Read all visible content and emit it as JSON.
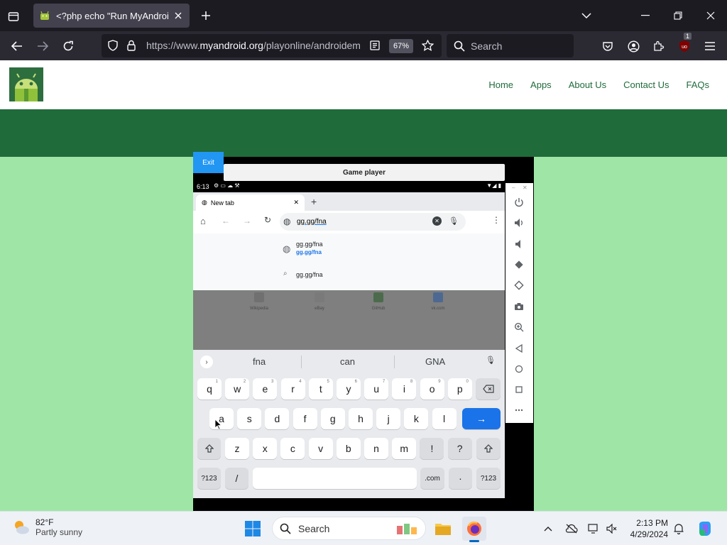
{
  "browser": {
    "tab_title": "<?php echo \"Run MyAndroid\"; ?>",
    "url_prefix": "https://www.",
    "url_domain": "myandroid.org",
    "url_path": "/playonline/androidem",
    "zoom": "67%",
    "search_placeholder": "Search",
    "extension_badge": "1"
  },
  "site": {
    "nav": [
      "Home",
      "Apps",
      "About Us",
      "Contact Us",
      "FAQs"
    ],
    "exit_label": "Exit",
    "player_title": "Game player"
  },
  "phone": {
    "time": "6:13",
    "tab_label": "New tab",
    "omnibox_text": "gg.gg/fna",
    "suggestion1_title": "gg.gg/fna",
    "suggestion1_url": "gg.gg/fna",
    "suggestion2": "gg.gg/fna",
    "shortcuts": [
      "Wikipedia",
      "eBay",
      "GitHub",
      "vk.com"
    ],
    "keyboard_suggestions": [
      "fna",
      "can",
      "GNA"
    ],
    "row1": [
      "q",
      "w",
      "e",
      "r",
      "t",
      "y",
      "u",
      "i",
      "o",
      "p"
    ],
    "row1_hints": [
      "1",
      "2",
      "3",
      "4",
      "5",
      "6",
      "7",
      "8",
      "9",
      "0"
    ],
    "row2": [
      "a",
      "s",
      "d",
      "f",
      "g",
      "h",
      "j",
      "k",
      "l"
    ],
    "row3": [
      "z",
      "x",
      "c",
      "v",
      "b",
      "n",
      "m",
      "!",
      "?"
    ],
    "symbols_key": "?123",
    "slash_key": "/",
    "dotcom_key": ".com",
    "period_key": "·",
    "enter_key": "→"
  },
  "taskbar": {
    "temperature": "82°F",
    "condition": "Partly sunny",
    "search_label": "Search",
    "time": "2:13 PM",
    "date": "4/29/2024"
  },
  "colors": {
    "site_green": "#1f6b3a",
    "page_bg": "#9fe6a6",
    "exit_blue": "#2196f3",
    "enter_blue": "#1a73e8"
  }
}
